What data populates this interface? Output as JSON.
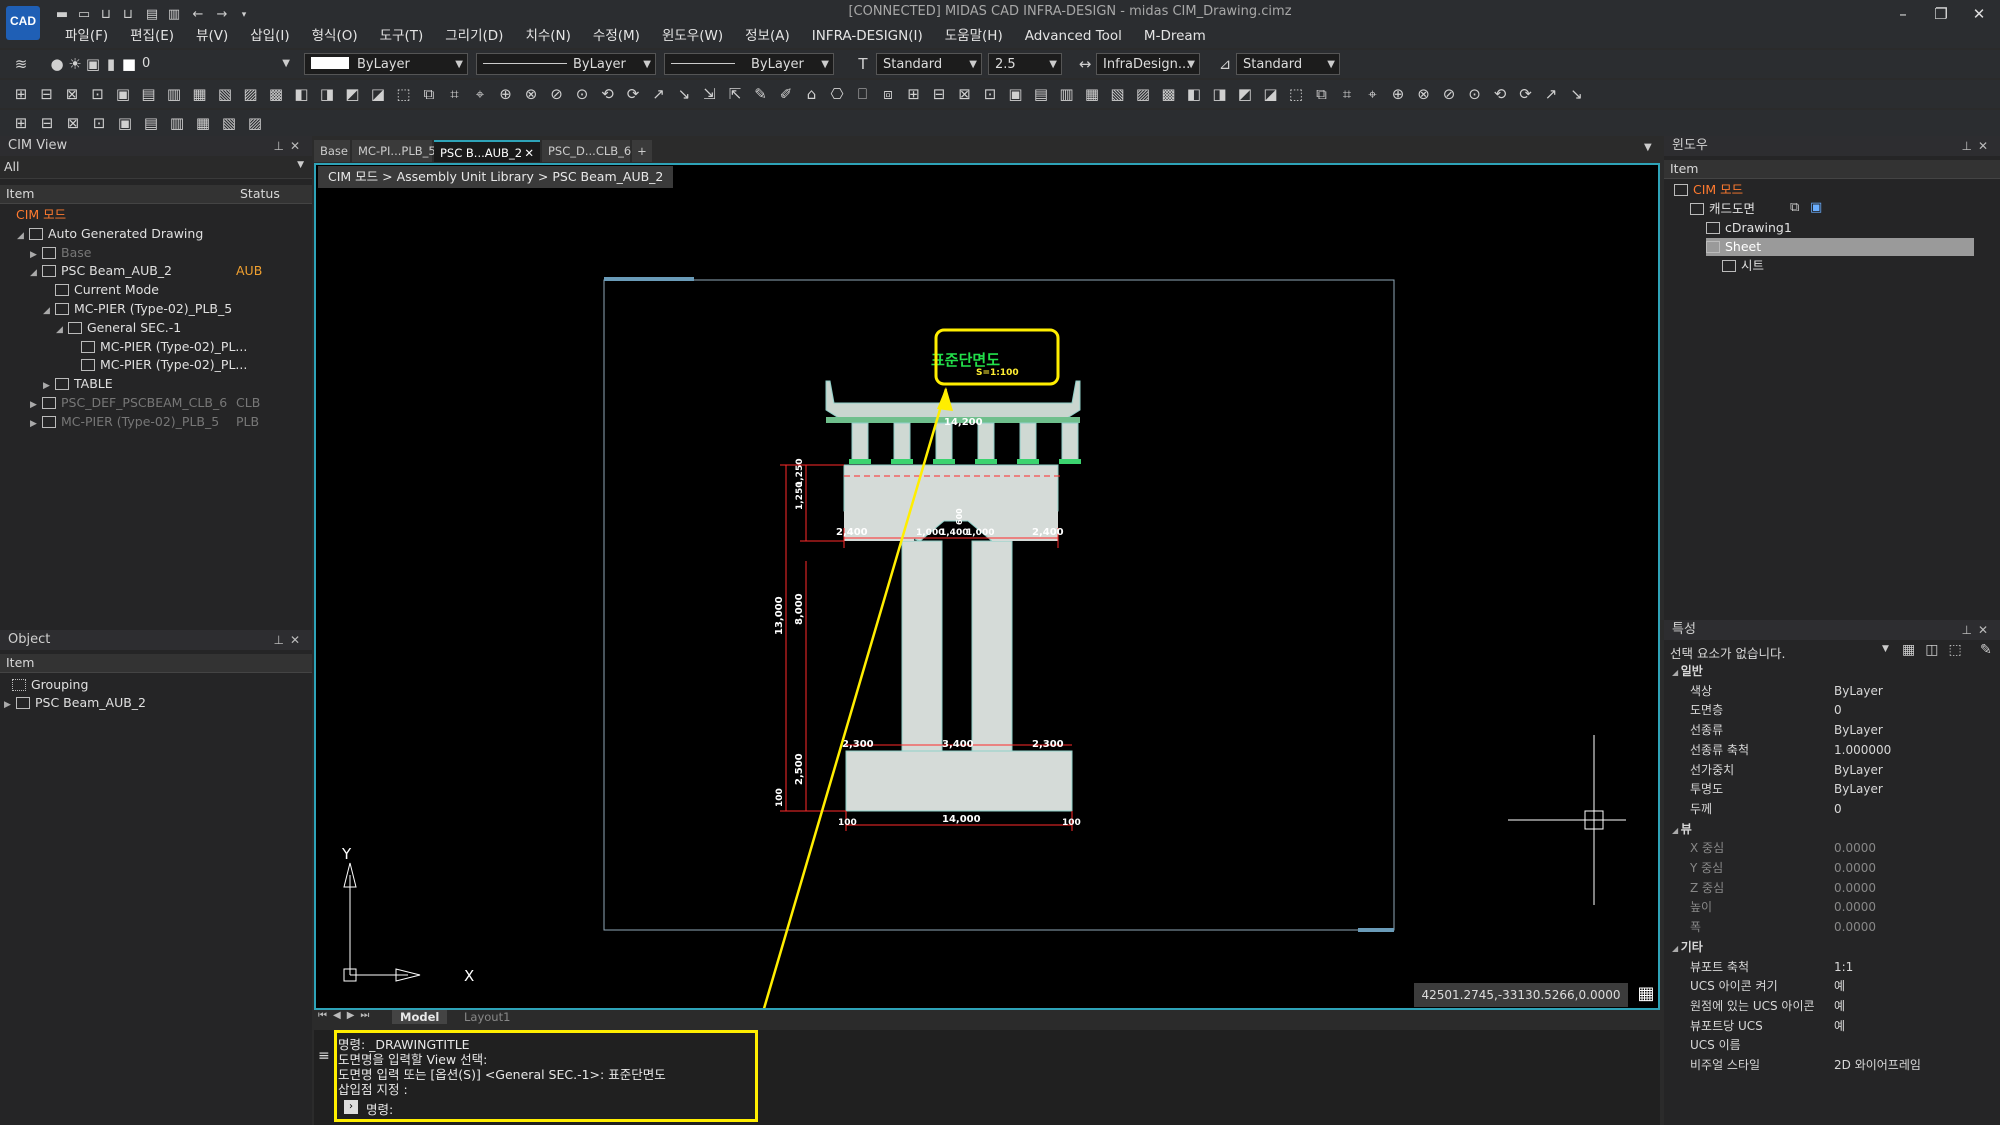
{
  "app": {
    "logo_text": "CAD",
    "window_title": "[CONNECTED] MIDAS CAD INFRA-DESIGN - midas CIM_Drawing.cimz",
    "menu": [
      "파일(F)",
      "편집(E)",
      "뷰(V)",
      "삽입(I)",
      "형식(O)",
      "도구(T)",
      "그리기(D)",
      "치수(N)",
      "수정(M)",
      "윈도우(W)",
      "정보(A)",
      "INFRA-DESIGN(I)",
      "도움말(H)",
      "Advanced Tool",
      "M-Dream"
    ]
  },
  "toolbar": {
    "layer_value": "0",
    "color_value": "ByLayer",
    "linetype_value": "ByLayer",
    "lineweight_value": "ByLayer",
    "text_style": "Standard",
    "text_height": "2.5",
    "dim_style": "InfraDesign...",
    "table_style": "Standard"
  },
  "cim_view": {
    "title": "CIM View",
    "filter": "All",
    "col_item": "Item",
    "col_status": "Status",
    "items": [
      {
        "label": "CIM 모드",
        "indent": 0,
        "exp": "",
        "status": "",
        "style": "orange"
      },
      {
        "label": "Auto Generated Drawing",
        "indent": 1,
        "exp": "◢",
        "status": "",
        "style": ""
      },
      {
        "label": "Base",
        "indent": 2,
        "exp": "▶",
        "status": "",
        "style": "dim"
      },
      {
        "label": "PSC Beam_AUB_2",
        "indent": 2,
        "exp": "◢",
        "status": "AUB",
        "style": ""
      },
      {
        "label": "Current Mode",
        "indent": 3,
        "exp": "",
        "status": "",
        "style": ""
      },
      {
        "label": "MC-PIER (Type-02)_PLB_5",
        "indent": 3,
        "exp": "◢",
        "status": "",
        "style": ""
      },
      {
        "label": "General SEC.-1",
        "indent": 4,
        "exp": "◢",
        "status": "",
        "style": ""
      },
      {
        "label": "MC-PIER (Type-02)_PL...",
        "indent": 5,
        "exp": "",
        "status": "",
        "style": ""
      },
      {
        "label": "MC-PIER (Type-02)_PL...",
        "indent": 5,
        "exp": "",
        "status": "",
        "style": ""
      },
      {
        "label": "TABLE",
        "indent": 3,
        "exp": "▶",
        "status": "",
        "style": ""
      },
      {
        "label": "PSC_DEF_PSCBEAM_CLB_6",
        "indent": 2,
        "exp": "▶",
        "status": "CLB",
        "style": "dim"
      },
      {
        "label": "MC-PIER (Type-02)_PLB_5",
        "indent": 2,
        "exp": "▶",
        "status": "PLB",
        "style": "dim"
      }
    ]
  },
  "object_panel": {
    "title": "Object",
    "col_item": "Item",
    "items": [
      "Grouping",
      "PSC Beam_AUB_2"
    ]
  },
  "doc_tabs": [
    "Base",
    "MC-PI...PLB_5",
    "PSC B...AUB_2",
    "PSC_D...CLB_6"
  ],
  "breadcrumb": "CIM 모드 > Assembly Unit Library > PSC Beam_AUB_2",
  "drawing": {
    "title": "표준단면도",
    "scale": "S=1:100",
    "dims": {
      "deck_width": "14,200",
      "cap_h1": "1,250",
      "cap_h2": "1,250",
      "left_overhang": "2,400",
      "right_overhang": "2,400",
      "inner1": "1,000",
      "inner2": "1,400",
      "inner3": "1,000",
      "arch": "600",
      "total_h": "13,000",
      "col_h": "8,000",
      "foot_h": "2,500",
      "foot_small": "100",
      "bottom_left": "2,300",
      "bottom_mid": "3,400",
      "bottom_right": "2,300",
      "base_width": "14,000",
      "edge_left": "100",
      "edge_right": "100"
    },
    "axis_x": "X",
    "axis_y": "Y"
  },
  "coords": "42501.2745,-33130.5266,0.0000",
  "layout_tabs": [
    "Model",
    "Layout1"
  ],
  "command": {
    "lines": [
      "명령: _DRAWINGTITLE",
      "도면명을 입력할 View 선택:",
      "도면명 입력 또는 [옵션(S)] <General SEC.-1>: 표준단면도",
      "삽입점 지정 :"
    ],
    "prompt": "명령:"
  },
  "window_panel": {
    "title": "윈도우",
    "col_item": "Item",
    "items": [
      {
        "label": "CIM 모드",
        "indent": 0,
        "style": "orange"
      },
      {
        "label": "캐드도면",
        "indent": 1,
        "style": ""
      },
      {
        "label": "cDrawing1",
        "indent": 2,
        "style": ""
      },
      {
        "label": "Sheet",
        "indent": 2,
        "style": "selected"
      },
      {
        "label": "시트",
        "indent": 3,
        "style": ""
      }
    ]
  },
  "properties": {
    "title": "특성",
    "selection": "선택 요소가 없습니다.",
    "groups": [
      {
        "name": "일반",
        "rows": [
          [
            "색상",
            "ByLayer"
          ],
          [
            "도면층",
            "0"
          ],
          [
            "선종류",
            "ByLayer"
          ],
          [
            "선종류 축척",
            "1.000000"
          ],
          [
            "선가중치",
            "ByLayer"
          ],
          [
            "투명도",
            "ByLayer"
          ],
          [
            "두께",
            "0"
          ]
        ]
      },
      {
        "name": "뷰",
        "rows": [
          [
            "X 중심",
            "0.0000"
          ],
          [
            "Y 중심",
            "0.0000"
          ],
          [
            "Z 중심",
            "0.0000"
          ],
          [
            "높이",
            "0.0000"
          ],
          [
            "폭",
            "0.0000"
          ]
        ]
      },
      {
        "name": "기타",
        "rows": [
          [
            "뷰포트 축척",
            "1:1"
          ],
          [
            "UCS 아이콘 켜기",
            "예"
          ],
          [
            "원점에 있는 UCS 아이콘",
            "예"
          ],
          [
            "뷰포트당 UCS",
            "예"
          ],
          [
            "UCS 이름",
            ""
          ],
          [
            "비주얼 스타일",
            "2D 와이어프레임"
          ]
        ]
      }
    ]
  }
}
